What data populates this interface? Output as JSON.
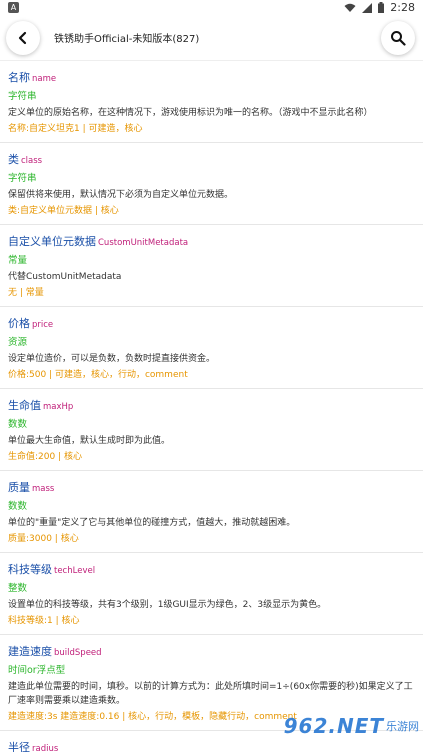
{
  "status_bar": {
    "time": "2:28",
    "left_badge": "A"
  },
  "header": {
    "title": "铁锈助手Official-未知版本(827)"
  },
  "items": [
    {
      "name": "名称",
      "code": "name",
      "type": "字符串",
      "desc": "定义单位的原始名称，在这种情况下，游戏使用标识为唯一的名称。（游戏中不显示此名称）",
      "meta": "名称:自定义坦克1 | 可建造，核心"
    },
    {
      "name": "类",
      "code": "class",
      "type": "字符串",
      "desc": "保留供将来使用，默认情况下必须为自定义单位元数据。",
      "meta": "类:自定义单位元数据 | 核心"
    },
    {
      "name": "自定义单位元数据",
      "code": "CustomUnitMetadata",
      "type": "常量",
      "desc": "代替CustomUnitMetadata",
      "meta": "无 | 常量"
    },
    {
      "name": "价格",
      "code": "price",
      "type": "资源",
      "desc": "设定单位造价，可以是负数，负数时提直接供资金。",
      "meta": "价格:500 | 可建造，核心，行动，comment"
    },
    {
      "name": "生命值",
      "code": "maxHp",
      "type": "数数",
      "desc": "单位最大生命值，默认生成时即为此值。",
      "meta": "生命值:200 | 核心"
    },
    {
      "name": "质量",
      "code": "mass",
      "type": "数数",
      "desc": "单位的\"重量\"定义了它与其他单位的碰撞方式，值越大，推动就越困难。",
      "meta": "质量:3000 | 核心"
    },
    {
      "name": "科技等级",
      "code": "techLevel",
      "type": "整数",
      "desc": "设置单位的科技等级，共有3个级别，1级GUI显示为绿色，2、3级显示为黄色。",
      "meta": "科技等级:1 | 核心"
    },
    {
      "name": "建造速度",
      "code": "buildSpeed",
      "type": "时间or浮点型",
      "desc": "建造此单位需要的时间，填秒。以前的计算方式为：此处所填时间=1÷(60x你需要的秒)如果定义了工厂速率则需要乘以建造乘数。",
      "meta": "建造速度:3s 建造速度:0.16 | 核心，行动，模板，隐藏行动，comment"
    },
    {
      "name": "半径",
      "code": "radius"
    }
  ],
  "watermark": {
    "text": "962.NET",
    "sub": "乐游网"
  },
  "colors": {
    "name": "#1a4fa8",
    "code": "#c0207a",
    "type": "#2bb52b",
    "meta": "#e69500"
  }
}
